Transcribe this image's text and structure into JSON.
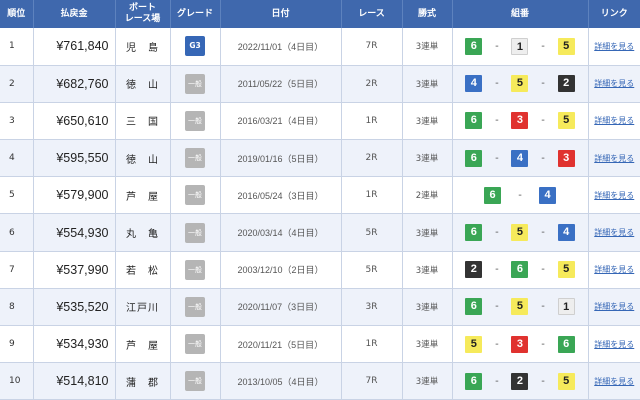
{
  "headers": {
    "rank": "順位",
    "payout": "払戻金",
    "venue_line1": "ボート",
    "venue_line2": "レース場",
    "grade": "グレード",
    "date": "日付",
    "race": "レース",
    "shiki": "勝式",
    "combo": "組番",
    "link": "リンク"
  },
  "box_colors": {
    "1": "#eeeeee",
    "2": "#333333",
    "3": "#e0322f",
    "4": "#3a70c4",
    "5": "#f6ea5b",
    "6": "#3aa655"
  },
  "rows": [
    {
      "rank": "1",
      "payout": "¥761,840",
      "venue": "児　島",
      "grade": "G3",
      "date": "2022/11/01（4日目）",
      "race": "7R",
      "shiki": "3連単",
      "combo": [
        "6",
        "1",
        "5"
      ],
      "link": "詳細を見る"
    },
    {
      "rank": "2",
      "payout": "¥682,760",
      "venue": "徳　山",
      "grade": "一般",
      "date": "2011/05/22（5日目）",
      "race": "2R",
      "shiki": "3連単",
      "combo": [
        "4",
        "5",
        "2"
      ],
      "link": "詳細を見る"
    },
    {
      "rank": "3",
      "payout": "¥650,610",
      "venue": "三　国",
      "grade": "一般",
      "date": "2016/03/21（4日目）",
      "race": "1R",
      "shiki": "3連単",
      "combo": [
        "6",
        "3",
        "5"
      ],
      "link": "詳細を見る"
    },
    {
      "rank": "4",
      "payout": "¥595,550",
      "venue": "徳　山",
      "grade": "一般",
      "date": "2019/01/16（5日目）",
      "race": "2R",
      "shiki": "3連単",
      "combo": [
        "6",
        "4",
        "3"
      ],
      "link": "詳細を見る"
    },
    {
      "rank": "5",
      "payout": "¥579,900",
      "venue": "芦　屋",
      "grade": "一般",
      "date": "2016/05/24（3日目）",
      "race": "1R",
      "shiki": "2連単",
      "combo": [
        "6",
        "4"
      ],
      "link": "詳細を見る"
    },
    {
      "rank": "6",
      "payout": "¥554,930",
      "venue": "丸　亀",
      "grade": "一般",
      "date": "2020/03/14（4日目）",
      "race": "5R",
      "shiki": "3連単",
      "combo": [
        "6",
        "5",
        "4"
      ],
      "link": "詳細を見る"
    },
    {
      "rank": "7",
      "payout": "¥537,990",
      "venue": "若　松",
      "grade": "一般",
      "date": "2003/12/10（2日目）",
      "race": "5R",
      "shiki": "3連単",
      "combo": [
        "2",
        "6",
        "5"
      ],
      "link": "詳細を見る"
    },
    {
      "rank": "8",
      "payout": "¥535,520",
      "venue": "江戸川",
      "grade": "一般",
      "date": "2020/11/07（3日目）",
      "race": "3R",
      "shiki": "3連単",
      "combo": [
        "6",
        "5",
        "1"
      ],
      "link": "詳細を見る"
    },
    {
      "rank": "9",
      "payout": "¥534,930",
      "venue": "芦　屋",
      "grade": "一般",
      "date": "2020/11/21（5日目）",
      "race": "1R",
      "shiki": "3連単",
      "combo": [
        "5",
        "3",
        "6"
      ],
      "link": "詳細を見る"
    },
    {
      "rank": "10",
      "payout": "¥514,810",
      "venue": "蒲　郡",
      "grade": "一般",
      "date": "2013/10/05（4日目）",
      "race": "7R",
      "shiki": "3連単",
      "combo": [
        "6",
        "2",
        "5"
      ],
      "link": "詳細を見る"
    }
  ]
}
